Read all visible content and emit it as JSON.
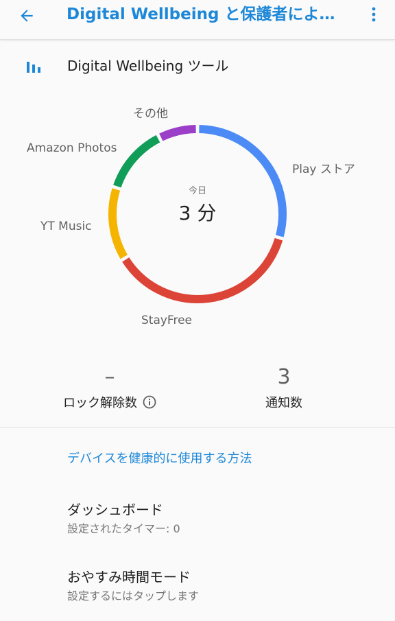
{
  "appbar": {
    "title": "Digital Wellbeing と保護者によ…",
    "back_icon": "arrow-left-icon",
    "menu_icon": "more-vert-icon"
  },
  "section": {
    "title": "Digital Wellbeing ツール",
    "icon": "bar-chart-icon"
  },
  "chart_data": {
    "type": "pie",
    "title": "",
    "center_caption": "今日",
    "center_value": "3 分",
    "slices": [
      {
        "name": "Play ストア",
        "value": 28,
        "color": "#4c8bf5"
      },
      {
        "name": "StayFree",
        "value": 35,
        "color": "#db4437"
      },
      {
        "name": "YT Music",
        "value": 13,
        "color": "#f4b400"
      },
      {
        "name": "Amazon Photos",
        "value": 12,
        "color": "#0f9d58"
      },
      {
        "name": "その他",
        "value": 7,
        "color": "#9c3fc8"
      }
    ]
  },
  "stats": {
    "unlocks": {
      "value": "–",
      "label": "ロック解除数"
    },
    "notifications": {
      "value": "3",
      "label": "通知数"
    }
  },
  "category": "デバイスを健康的に使用する方法",
  "items": [
    {
      "title": "ダッシュボード",
      "summary": "設定されたタイマー: 0"
    },
    {
      "title": "おやすみ時間モード",
      "summary": "設定するにはタップします"
    }
  ],
  "colors": {
    "accent": "#1e88d8"
  }
}
